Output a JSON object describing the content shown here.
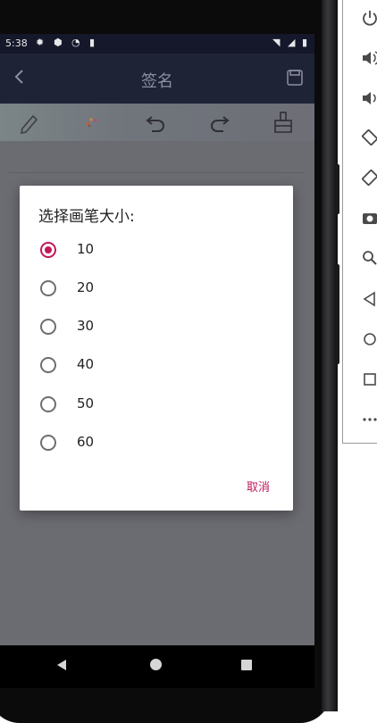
{
  "status_bar": {
    "time": "5:38"
  },
  "app_bar": {
    "title": "签名"
  },
  "tools": [
    "pencil-icon",
    "color-palette-icon",
    "undo-icon",
    "redo-icon",
    "eraser-icon"
  ],
  "dialog": {
    "title": "选择画笔大小:",
    "options": [
      "10",
      "20",
      "30",
      "40",
      "50",
      "60"
    ],
    "selected": "10",
    "cancel_label": "取消",
    "accent_color": "#c2185b"
  },
  "emulator_controls": [
    "power-icon",
    "volume-up-icon",
    "volume-down-icon",
    "rotate-left-icon",
    "rotate-right-icon",
    "camera-icon",
    "zoom-icon",
    "back-icon",
    "home-icon",
    "overview-icon",
    "more-icon"
  ]
}
